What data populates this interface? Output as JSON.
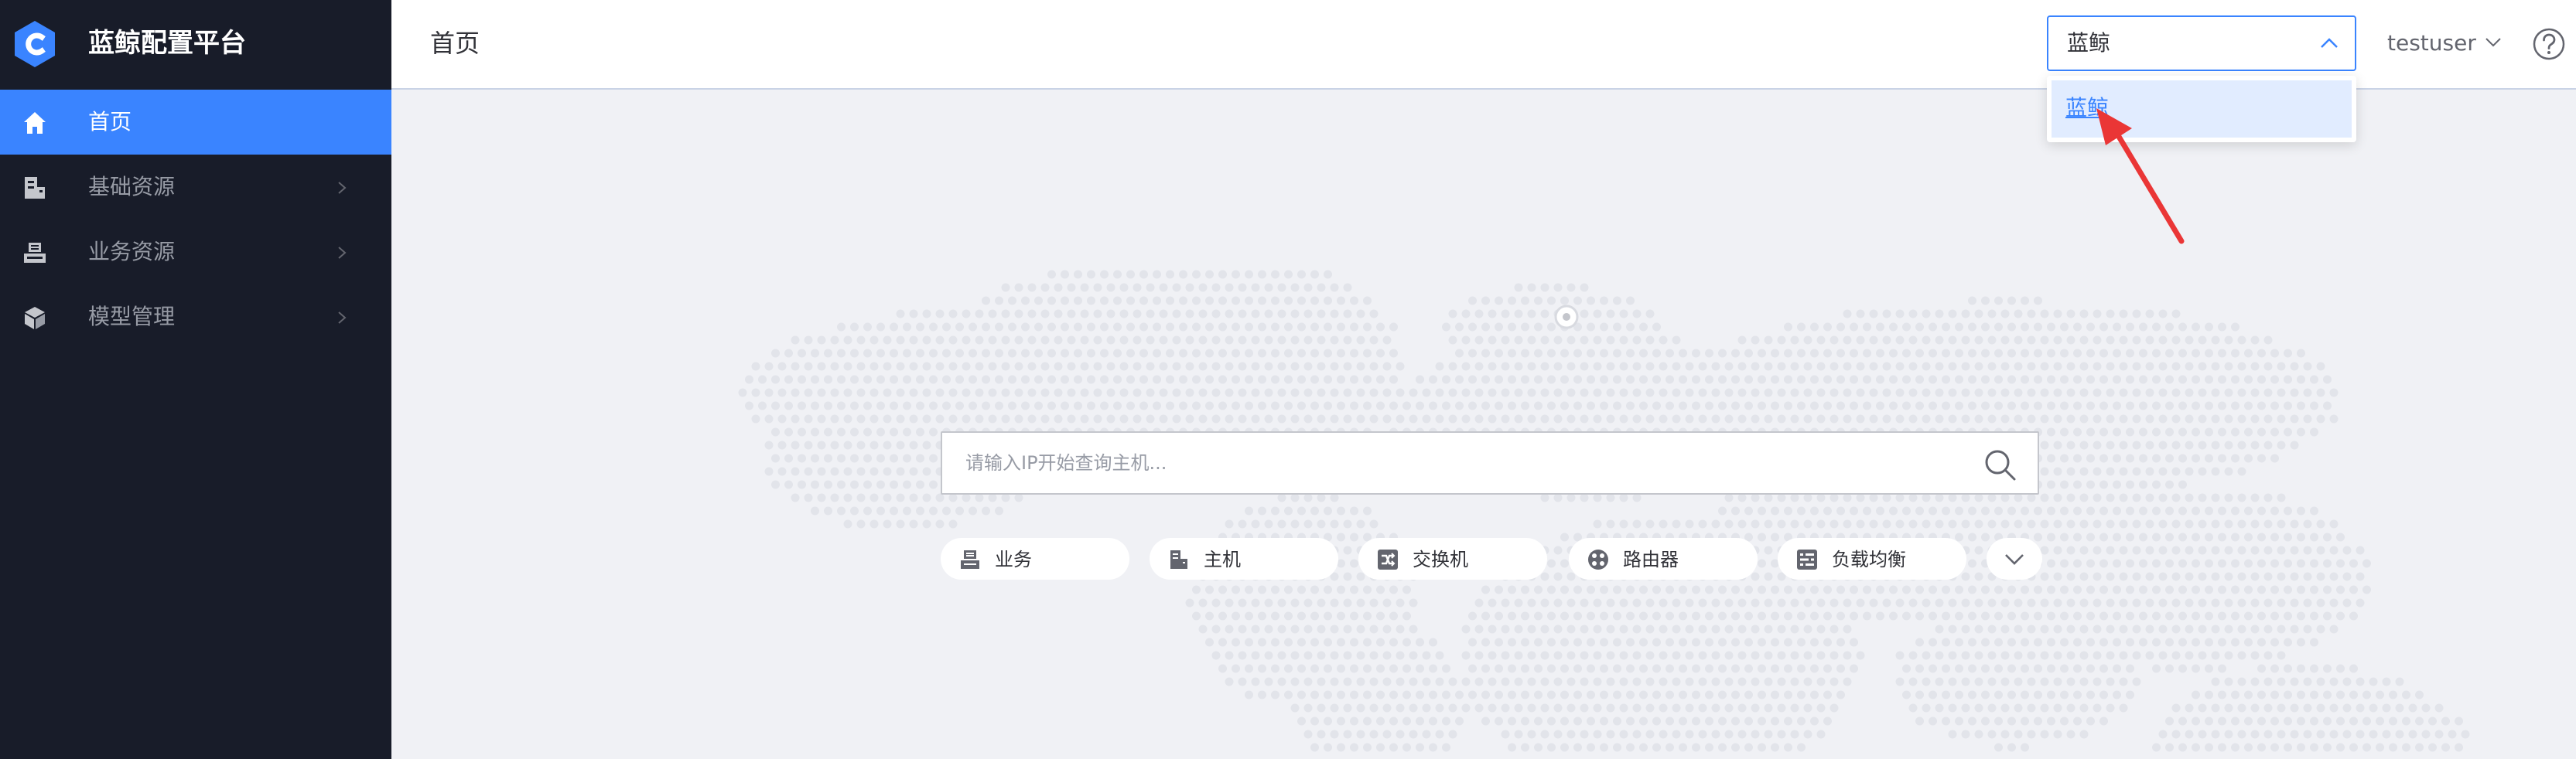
{
  "app": {
    "title": "蓝鲸配置平台"
  },
  "sidebar": {
    "items": [
      {
        "label": "首页",
        "icon": "home-icon",
        "active": true
      },
      {
        "label": "基础资源",
        "icon": "server-icon",
        "active": false
      },
      {
        "label": "业务资源",
        "icon": "business-icon",
        "active": false
      },
      {
        "label": "模型管理",
        "icon": "cube-icon",
        "active": false
      }
    ]
  },
  "header": {
    "page_title": "首页",
    "business_select": {
      "value": "蓝鲸",
      "options": [
        "蓝鲸"
      ]
    },
    "user": {
      "name": "testuser"
    },
    "help_icon": "question-circle-icon"
  },
  "main": {
    "search": {
      "placeholder": "请输入IP开始查询主机...",
      "value": ""
    },
    "shortcuts": [
      {
        "label": "业务",
        "icon": "business-icon"
      },
      {
        "label": "主机",
        "icon": "host-icon"
      },
      {
        "label": "交换机",
        "icon": "switch-icon"
      },
      {
        "label": "路由器",
        "icon": "router-icon"
      },
      {
        "label": "负载均衡",
        "icon": "load-balancer-icon"
      }
    ],
    "more_icon": "chevron-down-icon"
  },
  "colors": {
    "sidebar_bg": "#181c29",
    "accent": "#3a84ff",
    "main_bg": "#f0f1f5",
    "nav_text": "#979ba5",
    "option_hover": "#e1ecff",
    "annotation_arrow": "#ea3636"
  }
}
